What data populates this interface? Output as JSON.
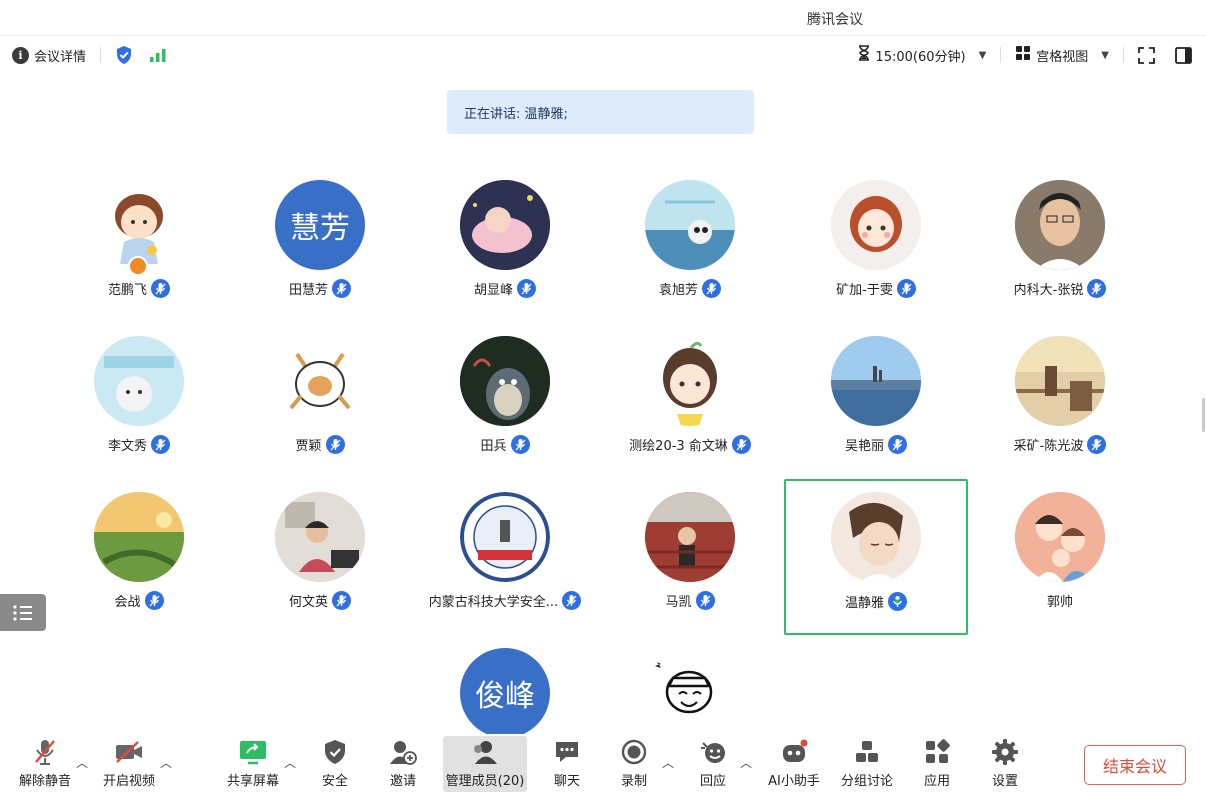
{
  "app": {
    "title": "腾讯会议"
  },
  "toolbar": {
    "meeting_details": "会议详情",
    "timer": "15:00(60分钟)",
    "view_mode": "宫格视图"
  },
  "speaking_banner": "正在讲话: 温静雅;",
  "participants": [
    {
      "name": "范鹏飞"
    },
    {
      "name": "田慧芳",
      "avatar_text": "慧芳"
    },
    {
      "name": "胡显峰"
    },
    {
      "name": "袁旭芳"
    },
    {
      "name": "矿加-于雯"
    },
    {
      "name": "内科大-张锐"
    },
    {
      "name": "李文秀"
    },
    {
      "name": "贾颖"
    },
    {
      "name": "田兵"
    },
    {
      "name": "测绘20-3  俞文琳"
    },
    {
      "name": "吴艳丽"
    },
    {
      "name": "采矿-陈光波"
    },
    {
      "name": "会战"
    },
    {
      "name": "何文英"
    },
    {
      "name": "内蒙古科技大学安全..."
    },
    {
      "name": "马凯"
    },
    {
      "name": "温静雅"
    },
    {
      "name": "郭帅"
    },
    {
      "avatar_text": "俊峰"
    },
    {}
  ],
  "bottom_bar": {
    "unmute": "解除静音",
    "start_video": "开启视频",
    "share_screen": "共享屏幕",
    "security": "安全",
    "invite": "邀请",
    "manage_members": "管理成员(20)",
    "chat": "聊天",
    "record": "录制",
    "replay": "回应",
    "ai_assistant": "AI小助手",
    "breakout": "分组讨论",
    "apps": "应用",
    "settings": "设置",
    "end_meeting": "结束会议"
  },
  "colors": {
    "accent_blue": "#2f6fe4",
    "active_border": "#2dbd62",
    "end_red": "#e04a39",
    "avatar_text_bg": "#3a6fc7",
    "banner_bg": "#deebfb"
  }
}
